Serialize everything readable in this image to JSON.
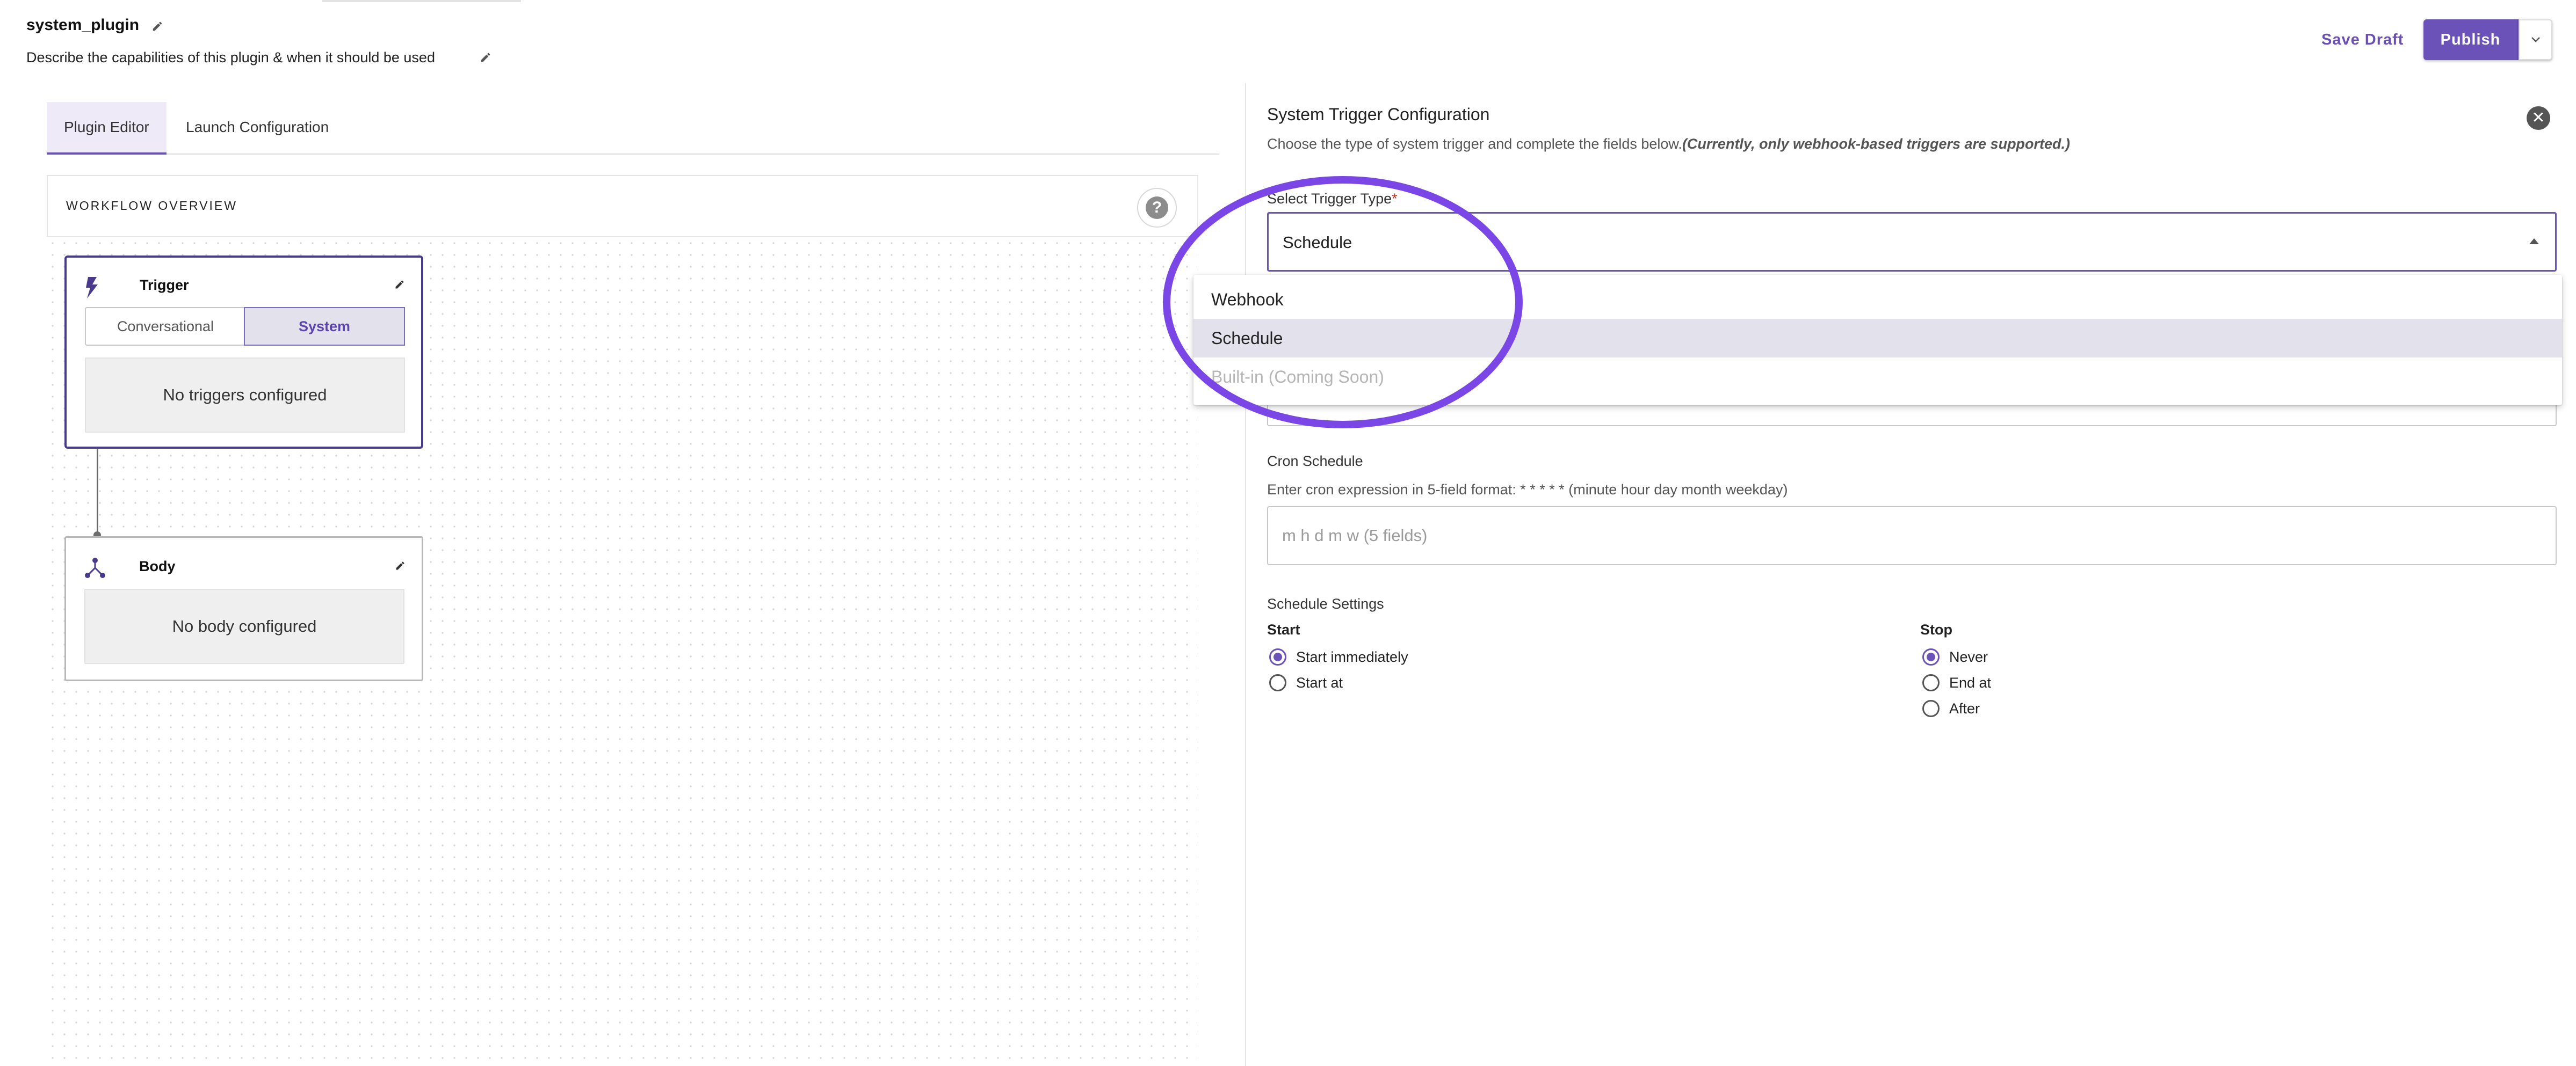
{
  "header": {
    "plugin_name": "system_plugin",
    "plugin_description": "Describe the capabilities of this plugin & when it should be used",
    "save_draft_label": "Save Draft",
    "publish_label": "Publish"
  },
  "tabs": [
    {
      "label": "Plugin Editor",
      "active": true
    },
    {
      "label": "Launch Configuration",
      "active": false
    }
  ],
  "workflow": {
    "title": "WORKFLOW OVERVIEW",
    "help_label": "?",
    "trigger_node": {
      "title": "Trigger",
      "toggle_options": [
        "Conversational",
        "System"
      ],
      "selected_toggle": "System",
      "empty_text": "No triggers configured"
    },
    "body_node": {
      "title": "Body",
      "empty_text": "No body configured"
    }
  },
  "panel": {
    "title": "System Trigger Configuration",
    "subtitle": "Choose the type of system trigger and complete the fields below.",
    "subtitle_note": "(Currently, only webhook-based triggers are supported.)",
    "close_label": "✕",
    "trigger_type_label": "Select Trigger Type",
    "required_mark": "*",
    "trigger_type_value": "Schedule",
    "trigger_type_options": [
      {
        "label": "Webhook",
        "highlighted": false,
        "disabled": false
      },
      {
        "label": "Schedule",
        "highlighted": true,
        "disabled": false
      },
      {
        "label": "Built-in (Coming Soon)",
        "highlighted": false,
        "disabled": true
      }
    ],
    "cron": {
      "label": "Cron Schedule",
      "help": "Enter cron expression in 5-field format: * * * * * (minute hour day month weekday)",
      "placeholder": "m h d m w (5 fields)",
      "value": ""
    },
    "schedule": {
      "label": "Schedule Settings",
      "start_heading": "Start",
      "start_options": [
        {
          "label": "Start immediately",
          "checked": true
        },
        {
          "label": "Start at",
          "checked": false
        }
      ],
      "stop_heading": "Stop",
      "stop_options": [
        {
          "label": "Never",
          "checked": true
        },
        {
          "label": "End at",
          "checked": false
        },
        {
          "label": "After",
          "checked": false
        }
      ]
    }
  },
  "colors": {
    "accent": "#6b52b8",
    "annotation": "#7a47e6",
    "highlight": "#e3e1ec"
  }
}
